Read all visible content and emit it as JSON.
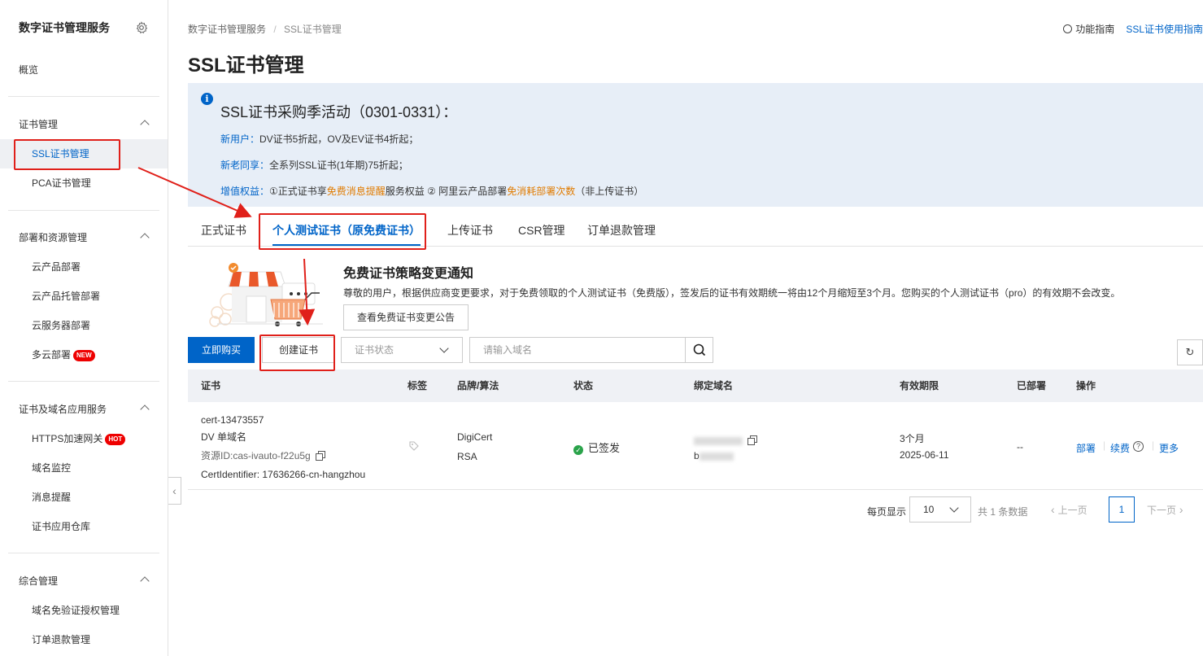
{
  "sidebar": {
    "title": "数字证书管理服务",
    "overview": "概览",
    "groups": [
      {
        "label": "证书管理",
        "items": [
          "SSL证书管理",
          "PCA证书管理"
        ]
      },
      {
        "label": "部署和资源管理",
        "items": [
          "云产品部署",
          "云产品托管部署",
          "云服务器部署",
          "多云部署"
        ]
      },
      {
        "label": "证书及域名应用服务",
        "items": [
          "HTTPS加速网关",
          "域名监控",
          "消息提醒",
          "证书应用仓库"
        ]
      },
      {
        "label": "综合管理",
        "items": [
          "域名免验证授权管理",
          "订单退款管理"
        ]
      }
    ],
    "badges": {
      "new": "NEW",
      "hot": "HOT"
    }
  },
  "breadcrumb": {
    "root": "数字证书管理服务",
    "sep": "/",
    "current": "SSL证书管理"
  },
  "toplinks": {
    "guide": "功能指南",
    "ssl_guide": "SSL证书使用指南"
  },
  "page_title": "SSL证书管理",
  "notice": {
    "title": "SSL证书采购季活动（0301-0331）：",
    "line1_label": "新用户：",
    "line1_text": "DV证书5折起，OV及EV证书4折起；",
    "line2_label": "新老同享：",
    "line2_text": "全系列SSL证书(1年期)75折起；",
    "line3_label": "增值权益：",
    "line3_a": "①正式证书享",
    "line3_b": "免费消息提醒",
    "line3_c": "服务权益  ② 阿里云产品部署",
    "line3_d": "免消耗部署次数",
    "line3_e": "（非上传证书）"
  },
  "tabs": [
    "正式证书",
    "个人测试证书（原免费证书）",
    "上传证书",
    "CSR管理",
    "订单退款管理"
  ],
  "banner": {
    "title": "免费证书策略变更通知",
    "text": "尊敬的用户，根据供应商变更要求，对于免费领取的个人测试证书（免费版），签发后的证书有效期统一将由12个月缩短至3个月。您购买的个人测试证书（pro）的有效期不会改变。",
    "button": "查看免费证书变更公告"
  },
  "toolbar": {
    "buy": "立即购买",
    "create": "创建证书",
    "status_placeholder": "证书状态",
    "search_placeholder": "请输入域名"
  },
  "table": {
    "headers": [
      "证书",
      "标签",
      "品牌/算法",
      "状态",
      "绑定域名",
      "有效期限",
      "已部署",
      "操作"
    ],
    "rows": [
      {
        "cert_name": "cert-13473557",
        "cert_type": "DV 单域名",
        "resource_id": "资源ID:cas-ivauto-f22u5g",
        "identifier": "CertIdentifier: 17636266-cn-hangzhou",
        "brand": "DigiCert",
        "algo": "RSA",
        "status": "已签发",
        "domain_prefix": "b",
        "validity": "3个月",
        "expire": "2025-06-11",
        "deployed": "--",
        "actions": [
          "部署",
          "续费",
          "更多"
        ]
      }
    ]
  },
  "pagination": {
    "per_page_label": "每页显示",
    "per_page": "10",
    "total": "共 1 条数据",
    "prev": "上一页",
    "page": "1",
    "next": "下一页"
  },
  "colors": {
    "accent": "#0064c8",
    "highlight": "#e07b00",
    "annotation": "#e0201a",
    "success": "#2aa34a"
  }
}
